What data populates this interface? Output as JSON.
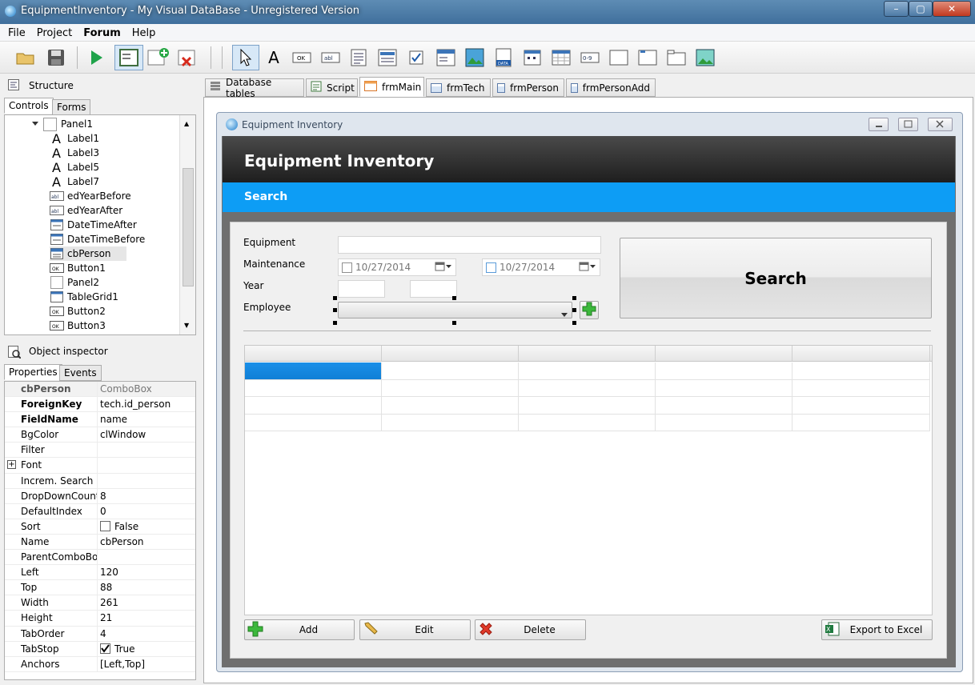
{
  "window": {
    "title": "EquipmentInventory - My Visual DataBase - Unregistered Version",
    "minimize": "–",
    "maximize": "▢",
    "close": "✕"
  },
  "menu": [
    "File",
    "Project",
    "Forum",
    "Help"
  ],
  "structure": {
    "title": "Structure",
    "tabs": [
      "Controls",
      "Forms"
    ],
    "root": "Panel1",
    "items": [
      {
        "label": "Label1",
        "icon": "label-icon"
      },
      {
        "label": "Label3",
        "icon": "label-icon"
      },
      {
        "label": "Label5",
        "icon": "label-icon"
      },
      {
        "label": "Label7",
        "icon": "label-icon"
      },
      {
        "label": "edYearBefore",
        "icon": "edit-icon"
      },
      {
        "label": "edYearAfter",
        "icon": "edit-icon"
      },
      {
        "label": "DateTimeAfter",
        "icon": "datetime-icon"
      },
      {
        "label": "DateTimeBefore",
        "icon": "datetime-icon"
      },
      {
        "label": "cbPerson",
        "icon": "combobox-icon"
      },
      {
        "label": "Button1",
        "icon": "button-icon"
      },
      {
        "label": "Panel2",
        "icon": "panel-icon"
      },
      {
        "label": "TableGrid1",
        "icon": "grid-icon"
      },
      {
        "label": "Button2",
        "icon": "button-icon"
      },
      {
        "label": "Button3",
        "icon": "button-icon"
      }
    ],
    "icon_text": {
      "label": "A",
      "edit": "abl",
      "button": "OK"
    }
  },
  "inspector": {
    "title": "Object inspector",
    "tabs": [
      "Properties",
      "Events"
    ],
    "object_name": "cbPerson",
    "object_type": "ComboBox",
    "rows": [
      {
        "key": "ForeignKey",
        "value": "tech.id_person",
        "bold": true
      },
      {
        "key": "FieldName",
        "value": "name",
        "bold": true
      },
      {
        "key": "BgColor",
        "value": "clWindow"
      },
      {
        "key": "Filter",
        "value": ""
      },
      {
        "key": "Font",
        "value": "",
        "expand": "+"
      },
      {
        "key": "Increm. Search",
        "value": ""
      },
      {
        "key": "DropDownCount",
        "value": "8"
      },
      {
        "key": "DefaultIndex",
        "value": "0"
      },
      {
        "key": "Sort",
        "value": "False",
        "check": "unchecked"
      },
      {
        "key": "Name",
        "value": "cbPerson"
      },
      {
        "key": "ParentComboBox",
        "value": ""
      },
      {
        "key": "Left",
        "value": "120"
      },
      {
        "key": "Top",
        "value": "88"
      },
      {
        "key": "Width",
        "value": "261"
      },
      {
        "key": "Height",
        "value": "21"
      },
      {
        "key": "TabOrder",
        "value": "4"
      },
      {
        "key": "TabStop",
        "value": "True",
        "check": "checked"
      },
      {
        "key": "Anchors",
        "value": "[Left,Top]"
      }
    ]
  },
  "doc_tabs": [
    "Database tables",
    "Script",
    "frmMain",
    "frmTech",
    "frmPerson",
    "frmPersonAdd"
  ],
  "active_tab": "frmMain",
  "form": {
    "title": "Equipment Inventory",
    "header": "Equipment Inventory",
    "search_bar": "Search",
    "labels": {
      "equipment": "Equipment",
      "maintenance": "Maintenance",
      "year": "Year",
      "employee": "Employee"
    },
    "date1": "10/27/2014",
    "date2": "10/27/2014",
    "search_button": "Search",
    "buttons": {
      "add": "Add",
      "edit": "Edit",
      "delete": "Delete",
      "export": "Export to Excel"
    }
  },
  "colors": {
    "accent_blue": "#0d9df5",
    "header_dark": "#2a2a2a",
    "selection": "#1a8fe8"
  }
}
